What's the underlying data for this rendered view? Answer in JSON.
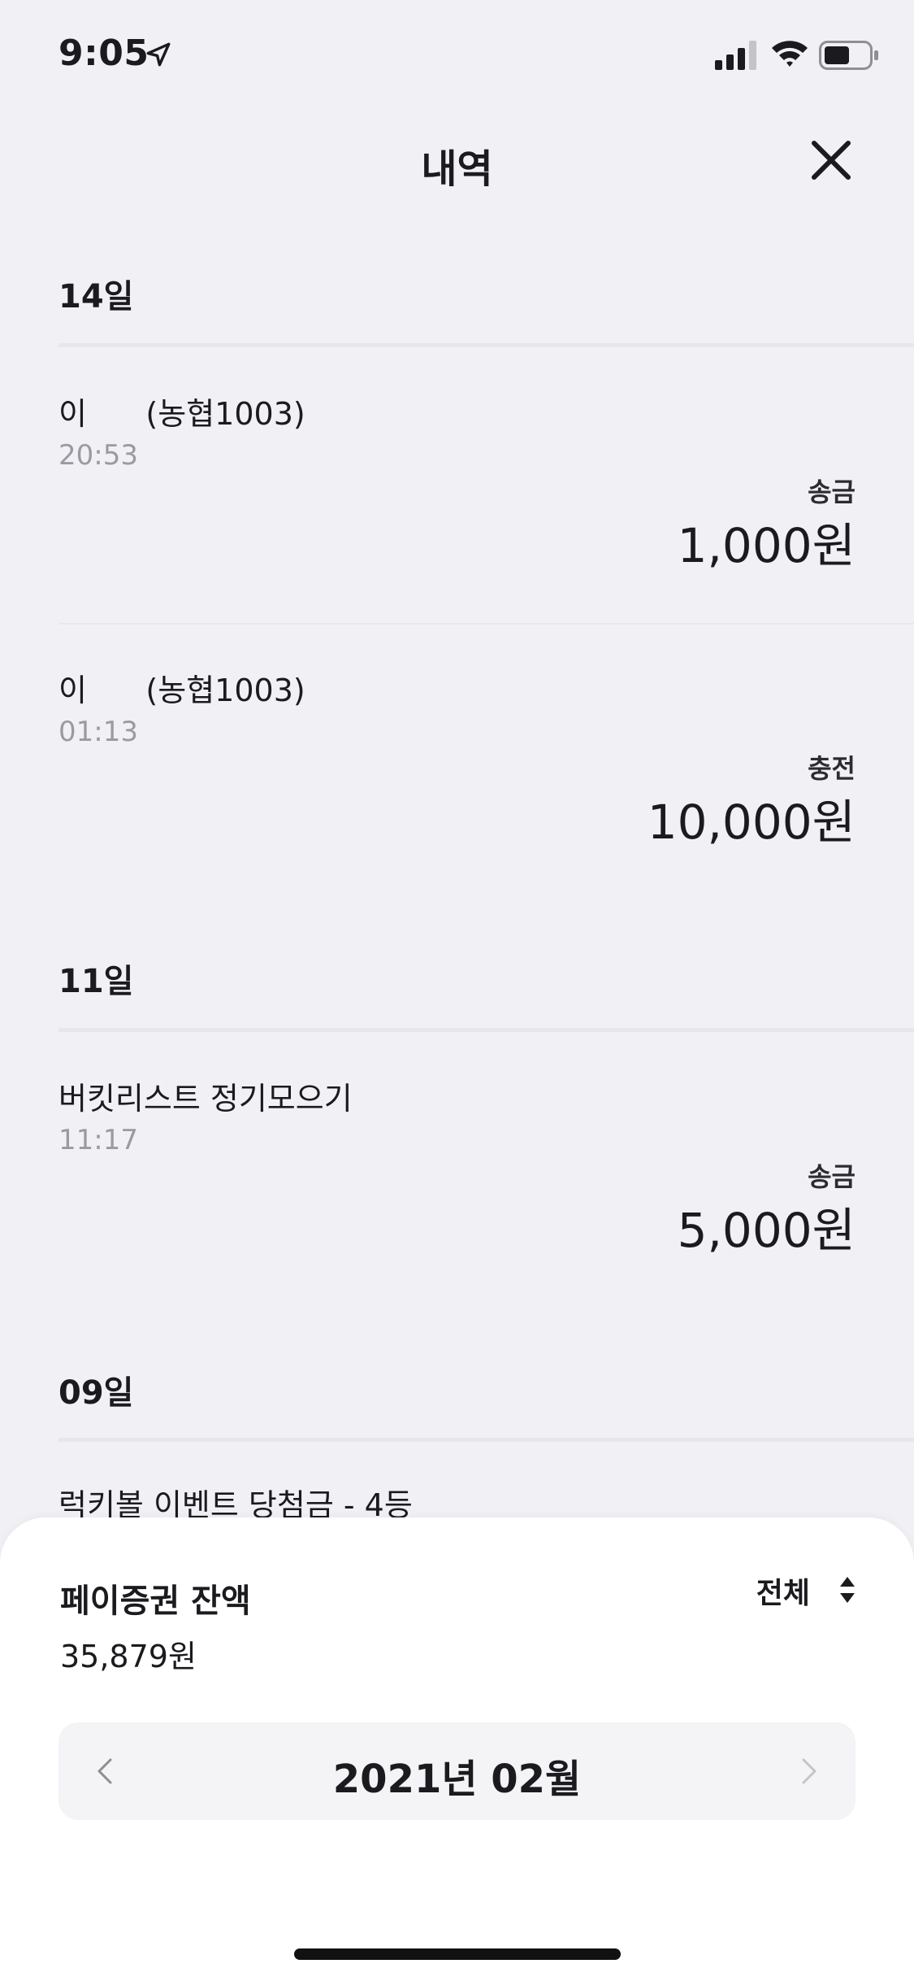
{
  "status_bar": {
    "time": "9:05"
  },
  "header": {
    "title": "내역"
  },
  "groups": [
    {
      "date": "14일",
      "transactions": [
        {
          "name": "이      (농협1003)",
          "time": "20:53",
          "type": "송금",
          "amount": "1,000원"
        },
        {
          "name": "이      (농협1003)",
          "time": "01:13",
          "type": "충전",
          "amount": "10,000원"
        }
      ]
    },
    {
      "date": "11일",
      "transactions": [
        {
          "name": "버킷리스트 정기모으기",
          "time": "11:17",
          "type": "송금",
          "amount": "5,000원"
        }
      ]
    },
    {
      "date": "09일",
      "transactions": [
        {
          "name": "럭키볼 이벤트 당첨금 - 4등"
        }
      ]
    }
  ],
  "bottom_sheet": {
    "balance_label": "페이증권 잔액",
    "balance_value": "35,879원",
    "filter_label": "전체",
    "month_label": "2021년 02월"
  },
  "colors": {
    "background": "#f1f1f5",
    "text": "#1b1b1f",
    "muted": "#9a9aa2",
    "sheet": "#ffffff"
  }
}
